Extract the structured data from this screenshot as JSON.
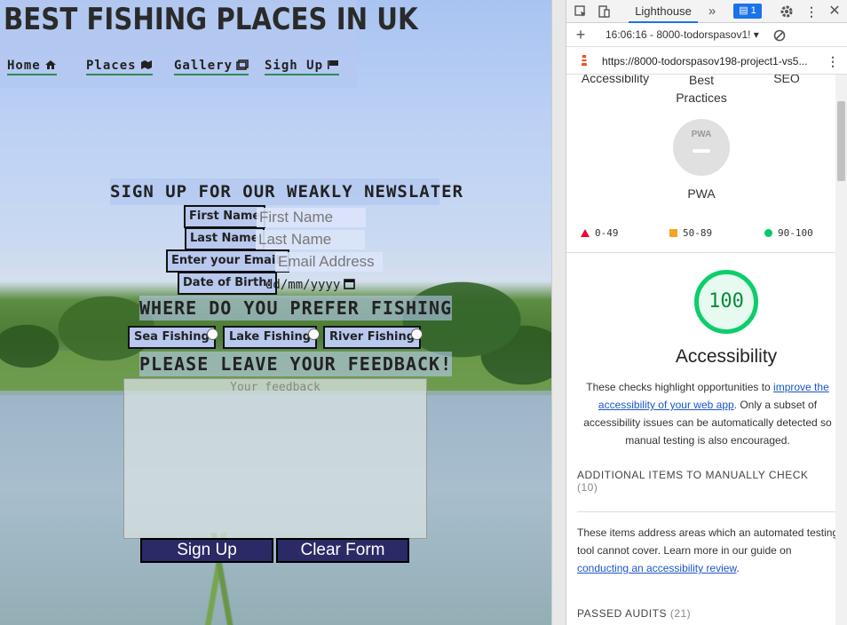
{
  "site": {
    "title": "BEST FISHING PLACES IN UK",
    "nav": [
      {
        "label": "Home",
        "icon": "home-icon"
      },
      {
        "label": "Places",
        "icon": "places-icon"
      },
      {
        "label": "Gallery",
        "icon": "gallery-icon"
      },
      {
        "label": "Sigh Up",
        "icon": "flag-icon"
      }
    ],
    "form": {
      "title": "SIGN UP FOR OUR WEAKLY NEWSLATER",
      "first_name_label": "First Name",
      "first_name_placeholder": "First Name",
      "last_name_label": "Last Name",
      "last_name_placeholder": "Last Name",
      "email_label": "Enter your Email:",
      "email_placeholder": "Email Address",
      "dob_label": "Date of Birth:",
      "dob_placeholder": "dd/mm/yyyy",
      "preference_heading": "WHERE DO YOU PREFER FISHING",
      "options": [
        "Sea Fishing",
        "Lake Fishing",
        "River Fishing"
      ],
      "feedback_heading": "PLEASE LEAVE YOUR FEEDBACK!",
      "feedback_placeholder": "Your feedback",
      "submit_label": "Sign Up",
      "clear_label": "Clear Form"
    }
  },
  "devtools": {
    "active_tab": "Lighthouse",
    "issues_count": "1",
    "report_selector": "16:06:16 - 8000-todorspasov1!",
    "url": "https://8000-todorspasov198-project1-vs5...",
    "categories": [
      "Accessibility",
      "Best Practices",
      "SEO"
    ],
    "pwa_badge": "PWA",
    "pwa_label": "PWA",
    "legend": [
      "0-49",
      "50-89",
      "90-100"
    ],
    "score": "100",
    "score_label": "Accessibility",
    "description_start": "These checks highlight opportunities to ",
    "description_link": "improve the accessibility of your web app",
    "description_end": ". Only a subset of accessibility issues can be automatically detected so manual testing is also encouraged.",
    "manual_title": "ADDITIONAL ITEMS TO MANUALLY CHECK",
    "manual_count": "(10)",
    "manual_text_start": "These items address areas which an automated testing tool cannot cover. Learn more in our guide on ",
    "manual_link": "conducting an accessibility review",
    "manual_text_end": ".",
    "passed_title": "PASSED AUDITS",
    "passed_count": "(21)",
    "colors": {
      "accent": "#1a73e8",
      "pass": "#0cce6b",
      "fail": "#ee0033",
      "average": "#f4a623"
    }
  }
}
